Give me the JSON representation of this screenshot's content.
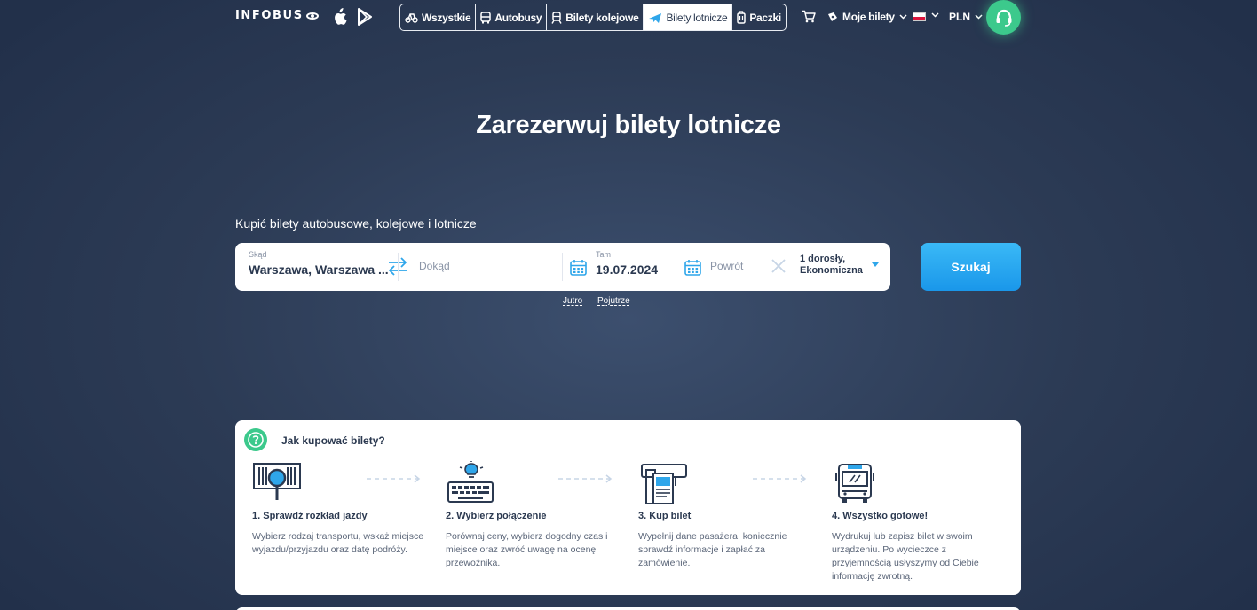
{
  "header": {
    "logo": "INFOBUS",
    "tabs": [
      {
        "label": "Wszystkie",
        "icon": "all-transport-icon",
        "active": false
      },
      {
        "label": "Autobusy",
        "icon": "bus-icon",
        "active": false
      },
      {
        "label": "Bilety kolejowe",
        "icon": "train-icon",
        "active": false
      },
      {
        "label": "Bilety lotnicze",
        "icon": "plane-icon",
        "active": true
      },
      {
        "label": "Paczki",
        "icon": "parcel-icon",
        "active": false
      }
    ],
    "my_tickets": "Moje bilety",
    "currency": "PLN"
  },
  "hero": {
    "title": "Zarezerwuj bilety lotnicze",
    "subtitle": "Kupić bilety autobusowe, kolejowe i lotnicze"
  },
  "search": {
    "from_label": "Skąd",
    "from_value": "Warszawa, Warszawa ...",
    "to_placeholder": "Dokąd",
    "depart_label": "Tam",
    "depart_value": "19.07.2024",
    "return_placeholder": "Powrót",
    "passengers_line1": "1 dorosły,",
    "passengers_line2": "Ekonomiczna",
    "button": "Szukaj",
    "quick_tomorrow": "Jutro",
    "quick_day_after": "Pojutrze"
  },
  "how_to_buy": {
    "title": "Jak kupować bilety?",
    "steps": [
      {
        "title": "1. Sprawdź rozkład jazdy",
        "desc": "Wybierz rodzaj transportu, wskaż miejsce wyjazdu/przyjazdu oraz datę podróży."
      },
      {
        "title": "2. Wybierz połączenie",
        "desc": "Porównaj ceny, wybierz dogodny czas i miejsce oraz zwróć uwagę na ocenę przewoźnika."
      },
      {
        "title": "3. Kup bilet",
        "desc": "Wypełnij dane pasażera, koniecznie sprawdź informacje i zapłać za zamówienie."
      },
      {
        "title": "4. Wszystko gotowe!",
        "desc": "Wydrukuj lub zapisz bilet w swoim urządzeniu. Po wycieczce z przyjemnością usłyszymy od Ciebie informację zwrotną."
      }
    ]
  },
  "colors": {
    "background": "#2c3b55",
    "accent_blue": "#1a97ea",
    "accent_green": "#3cc98c",
    "text_dark": "#2b3950"
  }
}
